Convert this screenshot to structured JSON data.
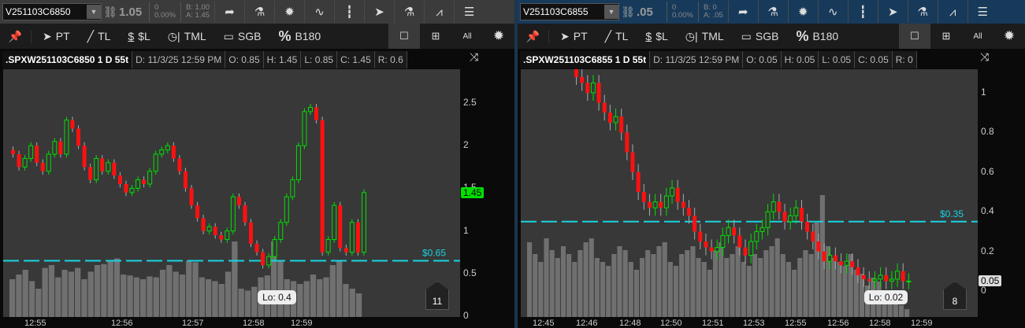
{
  "colors": {
    "up": "#00e000",
    "down": "#ff1010",
    "volume": "#707070",
    "priceline": "#19d3e0"
  },
  "left": {
    "symbol_field": "V251103C6850",
    "last": "1.05",
    "change": "0",
    "change_pct": "0.00%",
    "bid": "B: 1.00",
    "ask": "A: 1.45",
    "drawing_tools": [
      "PT",
      "TL",
      "$L",
      "TML",
      "SGB",
      "B180"
    ],
    "all_label": "All",
    "info": {
      "name": ".SPXW251103C6850 1 D 55t",
      "date": "D: 11/3/25 12:59 PM",
      "open": "O: 0.85",
      "high": "H: 1.45",
      "low": "L: 0.85",
      "close": "C: 1.45",
      "range": "R: 0.6"
    },
    "price_line_label": "$0.65",
    "last_badge": "1.45",
    "lo_label": "Lo: 0.4",
    "bubble_count": "11",
    "y_ticks": [
      "2.5",
      "2",
      "1.5",
      "1",
      "0.5",
      "0"
    ],
    "x_ticks": [
      "12:55",
      "12:56",
      "12:57",
      "12:58",
      "12:59"
    ]
  },
  "right": {
    "symbol_field": "V251103C6855",
    "last": ".05",
    "change": "0",
    "change_pct": "0.00%",
    "bid": "B: 0",
    "ask": "A: .05",
    "drawing_tools": [
      "PT",
      "TL",
      "$L",
      "TML",
      "SGB",
      "B180"
    ],
    "all_label": "All",
    "info": {
      "name": ".SPXW251103C6855 1 D 55t",
      "date": "D: 11/3/25 12:59 PM",
      "open": "O: 0.05",
      "high": "H: 0.05",
      "low": "L: 0.05",
      "close": "C: 0.05",
      "range": "R: 0"
    },
    "price_line_label": "$0.35",
    "last_badge": "0.05",
    "lo_label": "Lo: 0.02",
    "bubble_count": "8",
    "y_ticks": [
      "1",
      "0.8",
      "0.6",
      "0.4",
      "0.2",
      "0"
    ],
    "x_ticks": [
      "12:45",
      "12:46",
      "12:48",
      "12:50",
      "12:51",
      "12:53",
      "12:55",
      "12:56",
      "12:58",
      "12:59"
    ]
  },
  "chart_data": [
    {
      "type": "candlestick",
      "title": ".SPXW251103C6850 1 D 55t",
      "ylim": [
        0,
        2.6
      ],
      "price_line": 0.65,
      "closes": [
        1.9,
        1.75,
        1.85,
        2.0,
        1.8,
        1.7,
        1.9,
        2.05,
        1.9,
        2.3,
        2.2,
        2.0,
        1.75,
        1.6,
        1.85,
        1.7,
        1.8,
        1.65,
        1.55,
        1.45,
        1.5,
        1.6,
        1.55,
        1.7,
        1.9,
        1.95,
        2.0,
        1.85,
        1.7,
        1.5,
        1.3,
        1.15,
        1.0,
        1.05,
        0.95,
        0.9,
        1.0,
        1.4,
        1.3,
        1.1,
        0.85,
        0.75,
        0.6,
        0.7,
        0.9,
        1.1,
        1.4,
        1.6,
        2.0,
        2.4,
        2.45,
        2.3,
        0.75,
        0.9,
        1.3,
        0.8,
        0.75,
        1.1,
        0.75,
        1.45
      ],
      "volume": [
        40,
        45,
        50,
        38,
        30,
        52,
        55,
        42,
        50,
        48,
        52,
        40,
        48,
        55,
        56,
        60,
        62,
        45,
        44,
        42,
        40,
        43,
        42,
        50,
        55,
        48,
        45,
        60,
        58,
        42,
        40,
        38,
        35,
        48,
        80,
        30,
        28,
        32,
        42,
        44,
        80,
        60,
        40,
        38,
        35,
        38,
        45,
        40,
        42,
        55,
        60,
        35,
        30,
        25
      ]
    },
    {
      "type": "candlestick",
      "title": ".SPXW251103C6855 1 D 55t",
      "ylim": [
        0,
        1.15
      ],
      "price_line": 0.35,
      "closes": [
        1.08,
        1.05,
        1.0,
        1.05,
        0.95,
        0.9,
        0.85,
        0.88,
        0.8,
        0.7,
        0.6,
        0.5,
        0.45,
        0.42,
        0.45,
        0.42,
        0.48,
        0.52,
        0.45,
        0.42,
        0.38,
        0.3,
        0.25,
        0.22,
        0.2,
        0.22,
        0.28,
        0.32,
        0.28,
        0.22,
        0.18,
        0.25,
        0.3,
        0.32,
        0.4,
        0.45,
        0.4,
        0.35,
        0.38,
        0.42,
        0.35,
        0.3,
        0.25,
        0.2,
        0.15,
        0.18,
        0.15,
        0.13,
        0.15,
        0.12,
        0.08,
        0.06,
        0.05,
        0.06,
        0.08,
        0.05,
        0.06,
        0.1,
        0.05,
        0.05
      ],
      "volume": [
        95,
        80,
        70,
        100,
        85,
        75,
        90,
        80,
        70,
        85,
        95,
        100,
        75,
        70,
        65,
        80,
        90,
        85,
        70,
        60,
        75,
        85,
        80,
        90,
        95,
        70,
        65,
        80,
        85,
        90,
        75,
        70,
        60,
        85,
        95,
        75,
        80,
        90,
        70,
        65,
        80,
        75,
        85,
        90,
        100,
        80,
        70,
        60,
        75,
        85,
        80,
        120,
        155,
        90,
        75,
        70,
        65,
        80,
        60,
        55,
        40,
        50,
        45,
        30,
        25,
        20,
        15,
        10
      ]
    }
  ]
}
